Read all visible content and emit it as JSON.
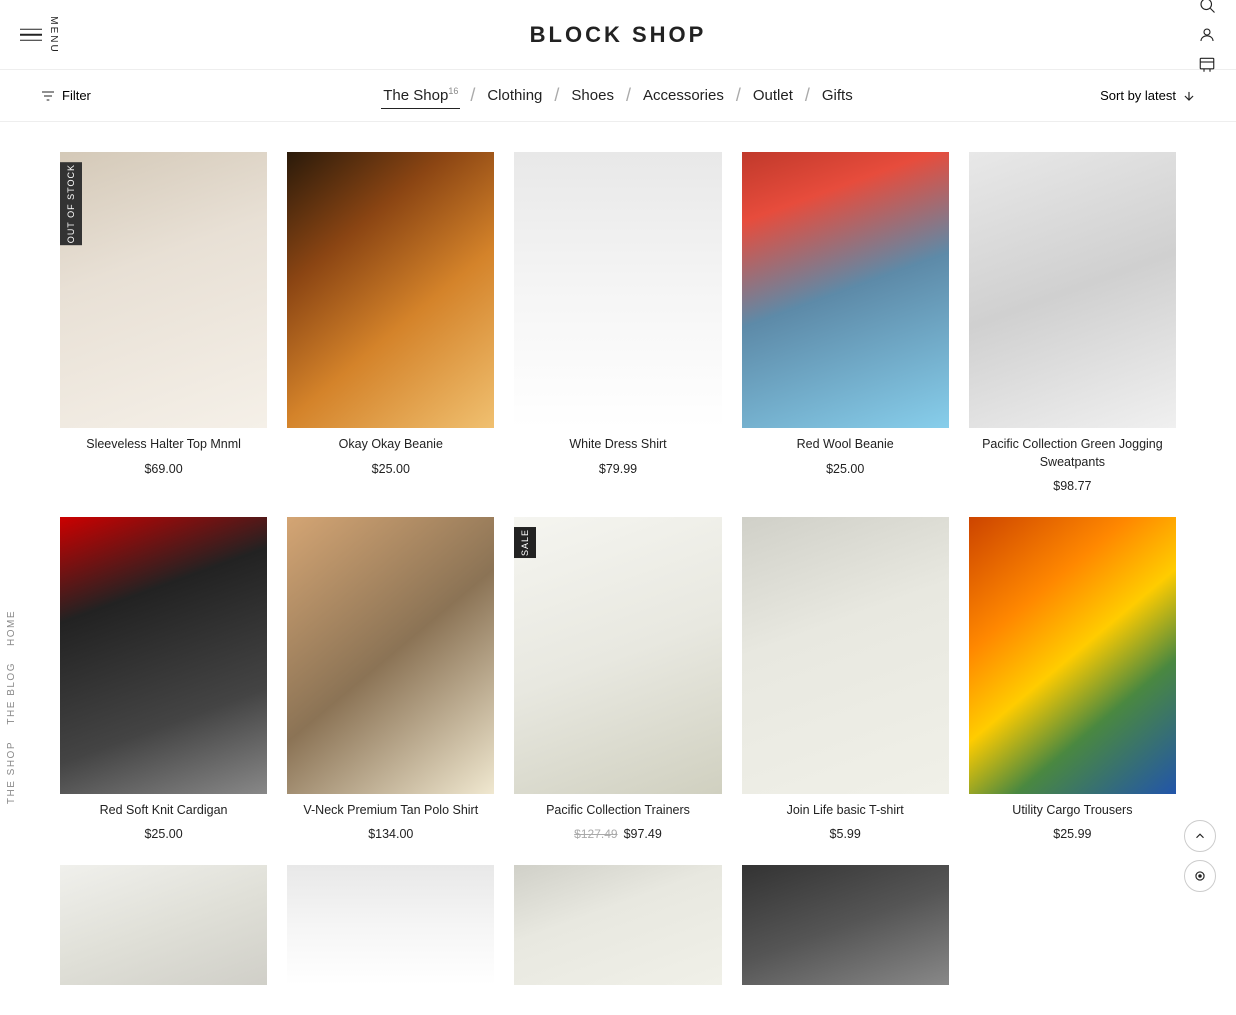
{
  "site": {
    "title": "BLOCK SHOP"
  },
  "header": {
    "menu_label": "Menu",
    "filter_label": "Filter",
    "sort_label": "Sort by latest"
  },
  "nav": {
    "items": [
      {
        "label": "The Shop",
        "badge": "16",
        "active": true
      },
      {
        "label": "Clothing",
        "active": false
      },
      {
        "label": "Shoes",
        "active": false
      },
      {
        "label": "Accessories",
        "active": false
      },
      {
        "label": "Outlet",
        "active": false
      },
      {
        "label": "Gifts",
        "active": false
      }
    ]
  },
  "side_labels": [
    "Home",
    "The Blog",
    "The Shop"
  ],
  "products": [
    {
      "id": 1,
      "name": "Sleeveless Halter Top Mnml",
      "price": "$69.00",
      "badge": "OUT OF STOCK",
      "badge_type": "out",
      "img_class": "img-1"
    },
    {
      "id": 2,
      "name": "Okay Okay Beanie",
      "price": "$25.00",
      "badge": null,
      "badge_type": null,
      "img_class": "img-2"
    },
    {
      "id": 3,
      "name": "White Dress Shirt",
      "price": "$79.99",
      "badge": null,
      "badge_type": null,
      "img_class": "img-3"
    },
    {
      "id": 4,
      "name": "Red Wool Beanie",
      "price": "$25.00",
      "badge": null,
      "badge_type": null,
      "img_class": "img-4"
    },
    {
      "id": 5,
      "name": "Pacific Collection Green Jogging Sweatpants",
      "price": "$98.77",
      "badge": null,
      "badge_type": null,
      "img_class": "img-5"
    },
    {
      "id": 6,
      "name": "Red Soft Knit Cardigan",
      "price": "$25.00",
      "badge": null,
      "badge_type": null,
      "img_class": "img-6"
    },
    {
      "id": 7,
      "name": "V-Neck Premium Tan Polo Shirt",
      "price": "$134.00",
      "badge": null,
      "badge_type": null,
      "img_class": "img-7"
    },
    {
      "id": 8,
      "name": "Pacific Collection Trainers",
      "price": "$97.49",
      "price_original": "$127.49",
      "badge": "SALE",
      "badge_type": "sale",
      "img_class": "img-8"
    },
    {
      "id": 9,
      "name": "Join Life basic T-shirt",
      "price": "$5.99",
      "badge": null,
      "badge_type": null,
      "img_class": "img-9"
    },
    {
      "id": 10,
      "name": "Utility Cargo Trousers",
      "price": "$25.99",
      "badge": null,
      "badge_type": null,
      "img_class": "img-10"
    },
    {
      "id": 11,
      "name": "",
      "price": "",
      "badge": null,
      "badge_type": null,
      "img_class": "img-11",
      "partial": true
    },
    {
      "id": 12,
      "name": "",
      "price": "",
      "badge": null,
      "badge_type": null,
      "img_class": "img-3",
      "partial": true
    },
    {
      "id": 13,
      "name": "",
      "price": "",
      "badge": null,
      "badge_type": null,
      "img_class": "img-9",
      "partial": true
    },
    {
      "id": 14,
      "name": "",
      "price": "",
      "badge": null,
      "badge_type": null,
      "img_class": "img-12",
      "partial": true
    }
  ]
}
